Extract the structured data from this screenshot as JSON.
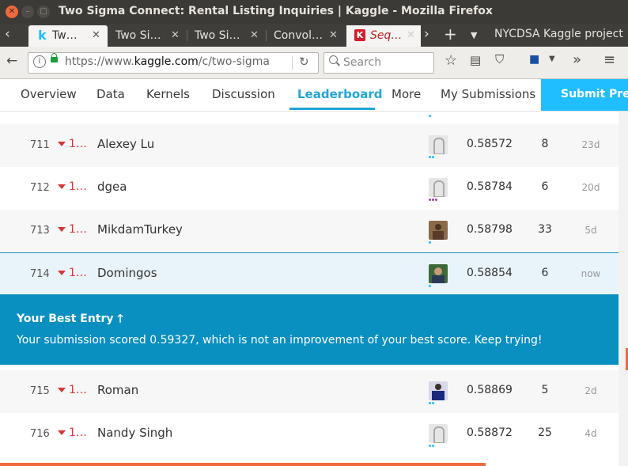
{
  "window": {
    "title": "Two Sigma Connect: Rental Listing Inquiries | Kaggle - Mozilla Firefox"
  },
  "tabs": [
    {
      "label": "Tw…",
      "active": true
    },
    {
      "label": "Two Si…"
    },
    {
      "label": "Two Si…"
    },
    {
      "label": "Convol…"
    },
    {
      "label": "Seq…",
      "selected": true
    }
  ],
  "tabbar": {
    "overflow_bookmark": "NYCDSA Kaggle project"
  },
  "navbar": {
    "url_prefix": "https://www.",
    "url_domain": "kaggle.com",
    "url_rest": "/c/two-sigma",
    "search_placeholder": "Search"
  },
  "kaggle_nav": {
    "items": [
      "Overview",
      "Data",
      "Kernels",
      "Discussion",
      "Leaderboard",
      "More",
      "My Submissions"
    ],
    "active": "Leaderboard",
    "submit_label": "Submit Pre"
  },
  "leaderboard": {
    "rows_before": [
      {
        "rank": "711",
        "delta": "1…",
        "team": "Alexey Lu",
        "avatar": "default-avatar",
        "dots": [
          "#20beff",
          "#20beff"
        ],
        "score": "0.58572",
        "entries": "8",
        "last": "23d"
      },
      {
        "rank": "712",
        "delta": "1…",
        "team": "dgea",
        "avatar": "default-avatar",
        "dots": [
          "#a040a0",
          "#a040a0",
          "#a040a0"
        ],
        "score": "0.58784",
        "entries": "6",
        "last": "20d"
      },
      {
        "rank": "713",
        "delta": "1…",
        "team": "MikdamTurkey",
        "avatar": "photo-avatar",
        "dots": [
          "#20beff"
        ],
        "score": "0.58798",
        "entries": "33",
        "last": "5d"
      },
      {
        "rank": "714",
        "delta": "1…",
        "team": "Domingos",
        "avatar": "photo-avatar",
        "dots": [
          "#20beff"
        ],
        "score": "0.58854",
        "entries": "6",
        "last": "now"
      }
    ],
    "best_entry": {
      "title": "Your Best Entry",
      "message": "Your submission scored 0.59327, which is not an improvement of your best score. Keep trying!"
    },
    "rows_after": [
      {
        "rank": "715",
        "delta": "1…",
        "team": "Roman",
        "avatar": "photo-avatar",
        "dots": [
          "#20beff",
          "#20beff"
        ],
        "score": "0.58869",
        "entries": "5",
        "last": "2d"
      },
      {
        "rank": "716",
        "delta": "1…",
        "team": "Nandy Singh",
        "avatar": "default-avatar",
        "dots": [
          "#20beff",
          "#20beff"
        ],
        "score": "0.58872",
        "entries": "25",
        "last": "4d"
      }
    ]
  },
  "colors": {
    "accent": "#20beff",
    "best_entry_bg": "#0a8fc1",
    "rank_down": "#dd3333"
  }
}
